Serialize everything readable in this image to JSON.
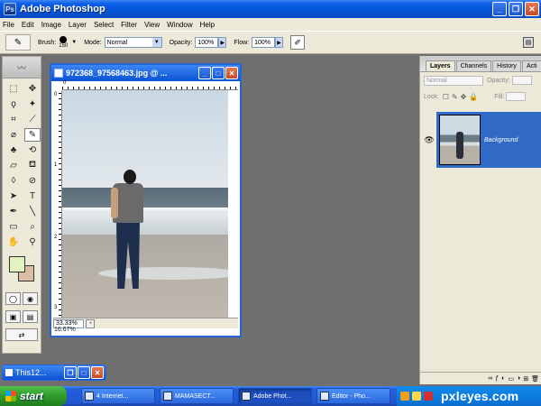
{
  "window": {
    "title": "Adobe Photoshop",
    "buttons": [
      "_",
      "❐",
      "✕"
    ]
  },
  "menu": [
    "File",
    "Edit",
    "Image",
    "Layer",
    "Select",
    "Filter",
    "View",
    "Window",
    "Help"
  ],
  "options": {
    "brush_label": "Brush:",
    "brush_size": "150",
    "mode_label": "Mode:",
    "mode_value": "Normal",
    "opacity_label": "Opacity:",
    "opacity_value": "100%",
    "flow_label": "Flow:",
    "flow_value": "100%"
  },
  "document": {
    "title": "972368_97568463.jpg @ ...",
    "zoom": "33.33%",
    "ruler_top": [
      "0"
    ],
    "ruler_left": [
      "0",
      "1",
      "2",
      "3"
    ],
    "behind_zoom": "16.67%"
  },
  "layers_panel": {
    "tabs": [
      "Layers",
      "Channels",
      "History",
      "Acti"
    ],
    "blend_mode": "Normal",
    "opacity_label": "Opacity:",
    "lock_label": "Lock:",
    "fill_label": "Fill:",
    "layer_name": "Background"
  },
  "minimized": {
    "title": "This12..."
  },
  "taskbar": {
    "start": "start",
    "tasks": [
      {
        "label": "4 Internet..."
      },
      {
        "label": "MAMASECT..."
      },
      {
        "label": "Adobe Phot..."
      },
      {
        "label": "Editor - Pho..."
      }
    ],
    "watermark": "pxleyes.com"
  },
  "colors": {
    "titlebar": "#0553d6",
    "foreground": "#e2f3c1",
    "background": "#d9bea4",
    "taskbar": "#245edb"
  }
}
